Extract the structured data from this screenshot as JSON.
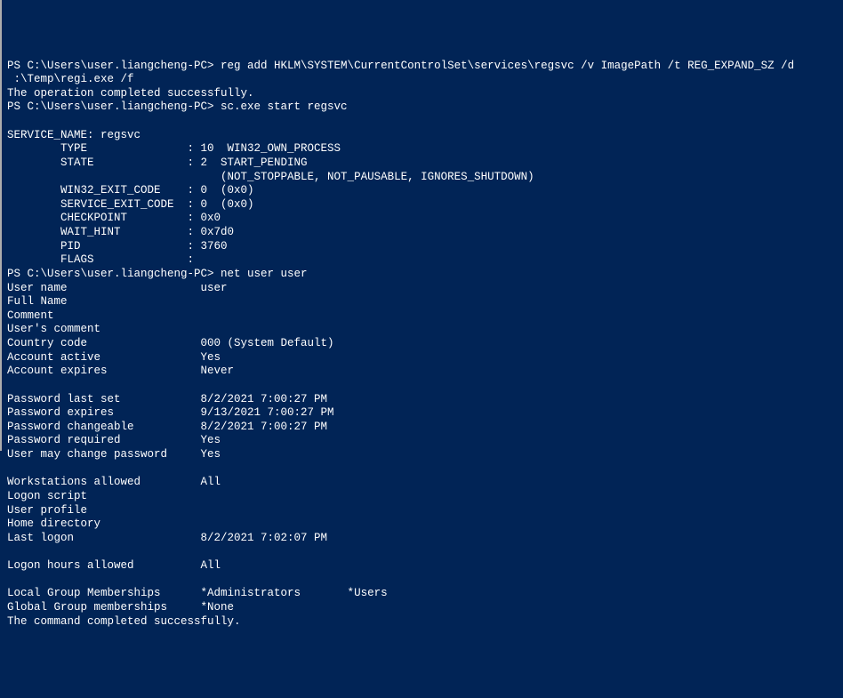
{
  "lines": [
    "PS C:\\Users\\user.liangcheng-PC> reg add HKLM\\SYSTEM\\CurrentControlSet\\services\\regsvc /v ImagePath /t REG_EXPAND_SZ /d",
    " :\\Temp\\regi.exe /f",
    "The operation completed successfully.",
    "PS C:\\Users\\user.liangcheng-PC> sc.exe start regsvc",
    "",
    "SERVICE_NAME: regsvc",
    "        TYPE               : 10  WIN32_OWN_PROCESS",
    "        STATE              : 2  START_PENDING",
    "                                (NOT_STOPPABLE, NOT_PAUSABLE, IGNORES_SHUTDOWN)",
    "        WIN32_EXIT_CODE    : 0  (0x0)",
    "        SERVICE_EXIT_CODE  : 0  (0x0)",
    "        CHECKPOINT         : 0x0",
    "        WAIT_HINT          : 0x7d0",
    "        PID                : 3760",
    "        FLAGS              :",
    "PS C:\\Users\\user.liangcheng-PC> net user user",
    "User name                    user",
    "Full Name",
    "Comment",
    "User's comment",
    "Country code                 000 (System Default)",
    "Account active               Yes",
    "Account expires              Never",
    "",
    "Password last set            8/2/2021 7:00:27 PM",
    "Password expires             9/13/2021 7:00:27 PM",
    "Password changeable          8/2/2021 7:00:27 PM",
    "Password required            Yes",
    "User may change password     Yes",
    "",
    "Workstations allowed         All",
    "Logon script",
    "User profile",
    "Home directory",
    "Last logon                   8/2/2021 7:02:07 PM",
    "",
    "Logon hours allowed          All",
    "",
    "Local Group Memberships      *Administrators       *Users",
    "Global Group memberships     *None",
    "The command completed successfully."
  ]
}
